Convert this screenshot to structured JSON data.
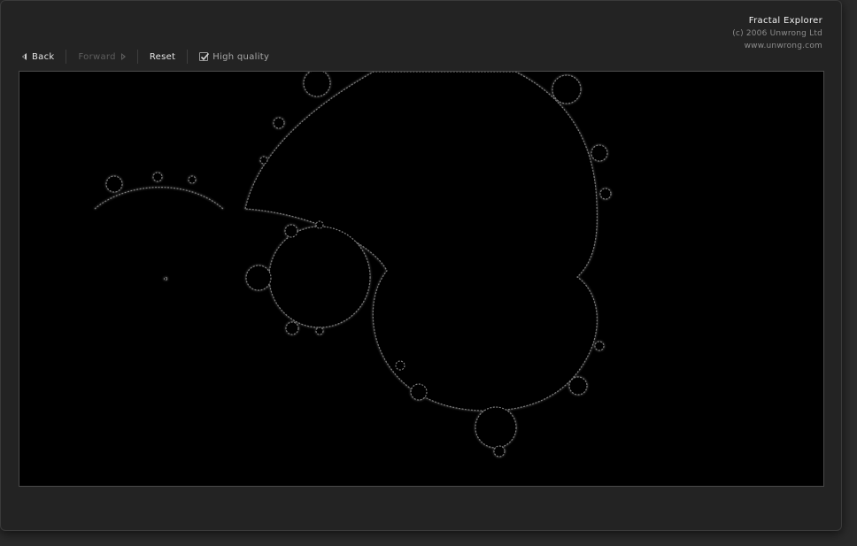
{
  "app": {
    "title": "Fractal Explorer",
    "copyright": "(c) 2006 Unwrong Ltd",
    "website": "www.unwrong.com"
  },
  "toolbar": {
    "back_label": "Back",
    "forward_label": "Forward",
    "reset_label": "Reset",
    "high_quality_label": "High quality",
    "high_quality_checked": true,
    "forward_enabled": false
  },
  "icons": {
    "back": "triangle-left-icon",
    "forward": "triangle-right-icon",
    "checkbox": "checkmark-icon"
  },
  "colors": {
    "window_bg": "#232323",
    "viewport_bg": "#000000",
    "fractal_edge": "#8a8a8a",
    "title_text": "#f2f2f2",
    "muted_text": "#8c8c8c"
  }
}
